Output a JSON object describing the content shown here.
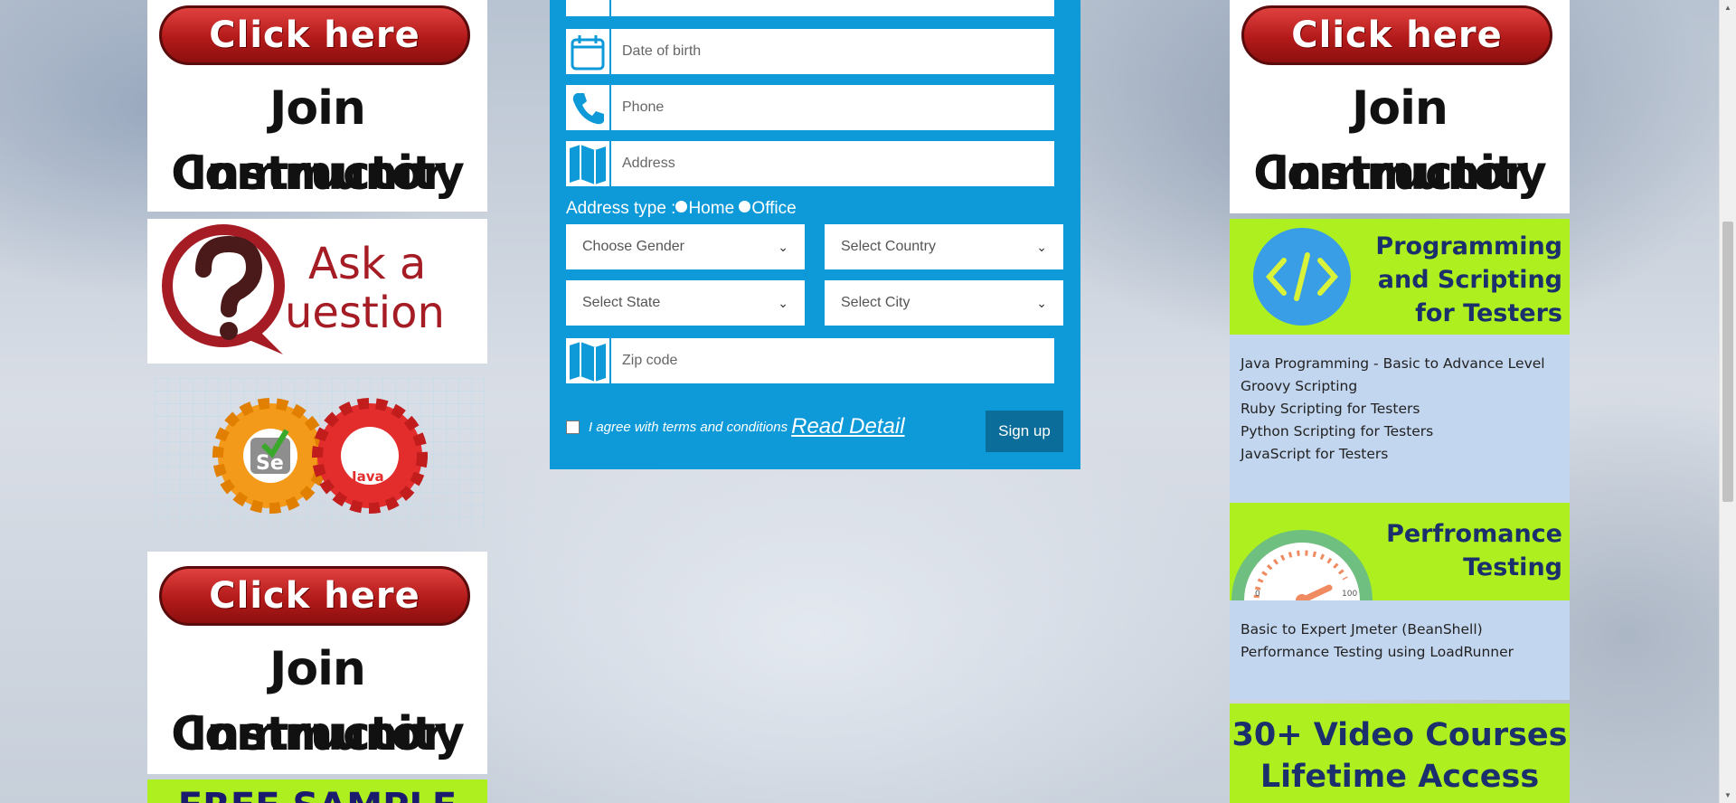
{
  "left_column": {
    "top_ad": {
      "button": "Click here",
      "line1": "Join Instructor",
      "line2": "Community"
    },
    "ask_ad": {
      "line1": "Ask a",
      "line2": "uestion"
    },
    "gear_ad": {
      "gear1": "Se",
      "gear2": "Java"
    },
    "bottom_ad": {
      "button": "Click here",
      "line1": "Join Instructor",
      "line2": "Community"
    },
    "free_sample": "FREE SAMPLE"
  },
  "form": {
    "dob_placeholder": "Date of birth",
    "phone_placeholder": "Phone",
    "address_placeholder": "Address",
    "address_type_label": "Address type :",
    "address_type_options": [
      "Home",
      "Office"
    ],
    "gender_select": "Choose Gender",
    "country_select": "Select Country",
    "state_select": "Select State",
    "city_select": "Select City",
    "zip_placeholder": "Zip code",
    "terms_text": "I agree with terms and conditions",
    "read_detail": "Read Detail",
    "signup_label": "Sign up"
  },
  "right_column": {
    "top_ad": {
      "button": "Click here",
      "line1": "Join Instructor",
      "line2": "Community"
    },
    "prog_ad": {
      "title_lines": [
        "Programming",
        "and Scripting",
        "for Testers"
      ],
      "courses": [
        "Java Programming - Basic to Advance Level",
        "Groovy Scripting",
        "Ruby Scripting for Testers",
        "Python Scripting for Testers",
        "JavaScript for Testers"
      ]
    },
    "perf_ad": {
      "title_lines": [
        "Perfromance",
        "Testing"
      ],
      "gauge_min": "0",
      "gauge_max": "100",
      "courses": [
        "Basic to Expert Jmeter (BeanShell)",
        "Performance Testing using LoadRunner"
      ]
    },
    "video_ad": {
      "line1": "30+ Video Courses",
      "line2": "Lifetime Access"
    }
  },
  "colors": {
    "form_bg": "#0e9ad8",
    "signup_bg": "#0b6d99",
    "ad_green": "#aef01f",
    "list_blue": "#c3d6ef"
  }
}
